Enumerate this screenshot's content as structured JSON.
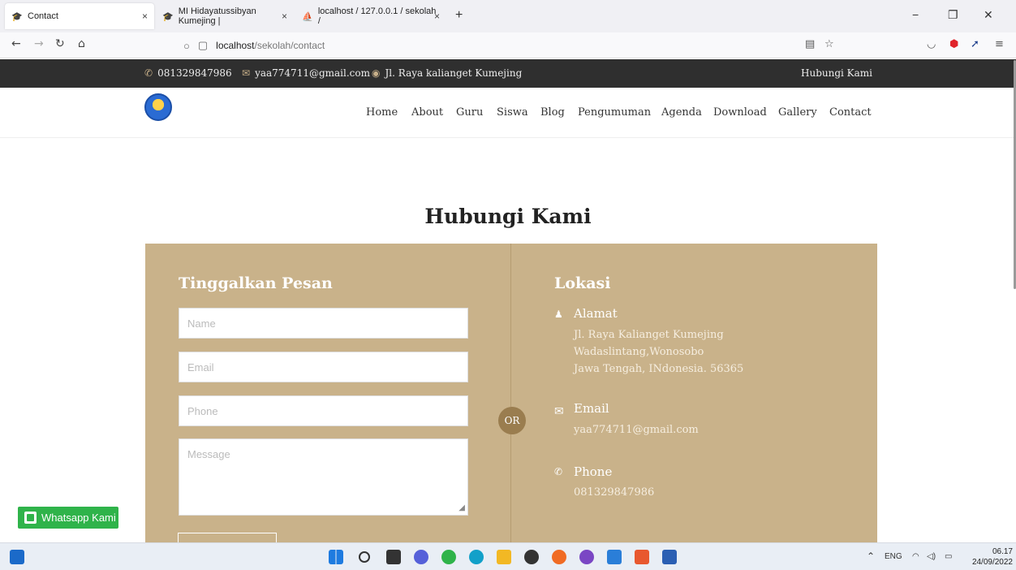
{
  "browser": {
    "tabs": [
      {
        "title": "Contact",
        "icon": "mortarboard-icon",
        "close": "×"
      },
      {
        "title": "MI Hidayatussibyan Kumejing |",
        "icon": "mortarboard-icon",
        "close": "×"
      },
      {
        "title": "localhost / 127.0.0.1 / sekolah /",
        "icon": "phpmyadmin-icon",
        "close": "×"
      }
    ],
    "new_tab": "+",
    "url_host": "localhost",
    "url_path": "/sekolah/contact"
  },
  "topbar": {
    "phone": "081329847986",
    "email": "yaa774711@gmail.com",
    "address": "Jl. Raya kalianget Kumejing",
    "hubungi": "Hubungi Kami"
  },
  "menu": [
    "Home",
    "About",
    "Guru",
    "Siswa",
    "Blog",
    "Pengumuman",
    "Agenda",
    "Download",
    "Gallery",
    "Contact"
  ],
  "page": {
    "heading": "Hubungi Kami",
    "form_title": "Tinggalkan Pesan",
    "placeholders": {
      "name": "Name",
      "email": "Email",
      "phone": "Phone",
      "message": "Message"
    },
    "or": "OR",
    "location_title": "Lokasi",
    "alamat_label": "Alamat",
    "alamat_lines": [
      "Jl. Raya Kalianget Kumejing",
      "Wadaslintang,Wonosobo",
      "Jawa Tengah, INdonesia. 56365"
    ],
    "email_label": "Email",
    "email_value": "yaa774711@gmail.com",
    "phone_label": "Phone",
    "phone_value": "081329847986"
  },
  "whatsapp": "Whatsapp Kami",
  "taskbar": {
    "lang": "ENG",
    "time": "06.17",
    "date": "24/09/2022"
  },
  "colors": {
    "panel": "#c9b28a",
    "topbar": "#2f2f2f",
    "whatsapp": "#2fb34a"
  }
}
